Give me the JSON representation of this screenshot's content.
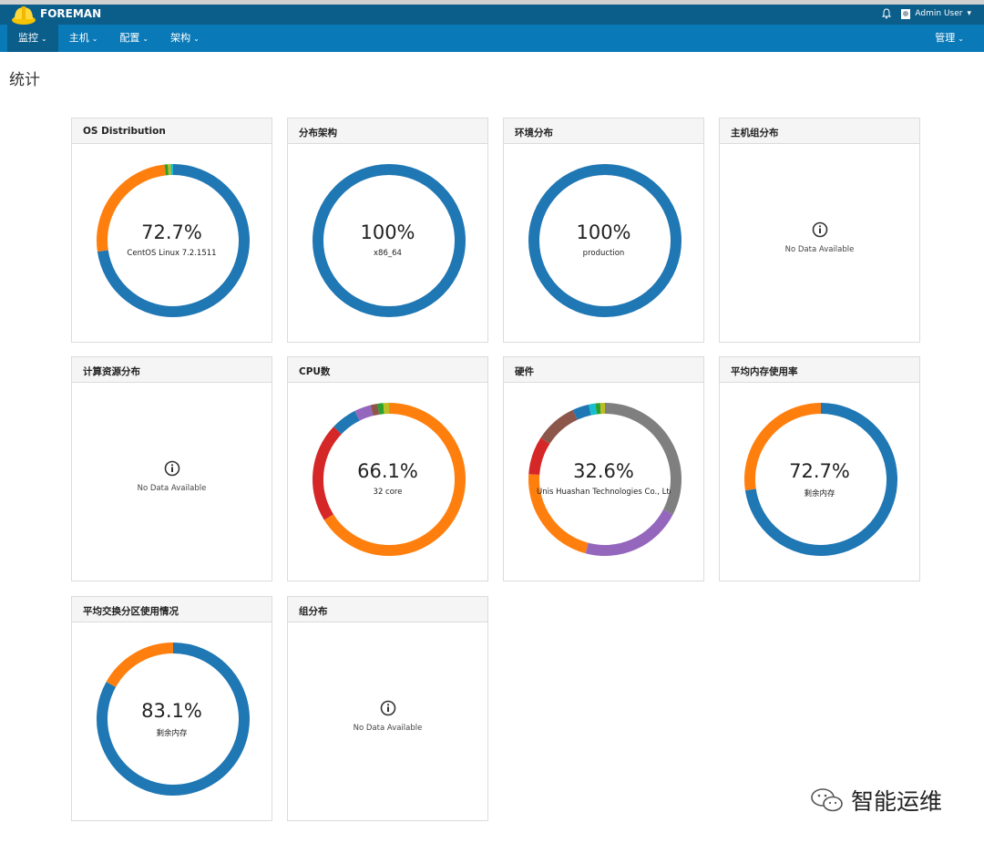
{
  "header": {
    "brand": "FOREMAN",
    "user": "Admin User",
    "user_caret": "▾"
  },
  "nav": {
    "items": [
      {
        "label": "监控",
        "caret": "⌄"
      },
      {
        "label": "主机",
        "caret": "⌄"
      },
      {
        "label": "配置",
        "caret": "⌄"
      },
      {
        "label": "架构",
        "caret": "⌄"
      }
    ],
    "admin": {
      "label": "管理",
      "caret": "⌄"
    }
  },
  "page": {
    "title": "统计"
  },
  "cards": [
    {
      "title": "OS Distribution",
      "percent": "72.7%",
      "label": "CentOS Linux 7.2.1511"
    },
    {
      "title": "分布架构",
      "percent": "100%",
      "label": "x86_64"
    },
    {
      "title": "环境分布",
      "percent": "100%",
      "label": "production"
    },
    {
      "title": "主机组分布",
      "nodata": "No Data Available"
    },
    {
      "title": "计算资源分布",
      "nodata": "No Data Available"
    },
    {
      "title": "CPU数",
      "percent": "66.1%",
      "label": "32 core"
    },
    {
      "title": "硬件",
      "percent": "32.6%",
      "label": "Unis Huashan Technologies Co., Ltd."
    },
    {
      "title": "平均内存使用率",
      "percent": "72.7%",
      "label": "剩余内存"
    },
    {
      "title": "平均交换分区使用情况",
      "percent": "83.1%",
      "label": "剩余内存"
    },
    {
      "title": "组分布",
      "nodata": "No Data Available"
    }
  ],
  "chart_data": [
    {
      "type": "pie",
      "title": "OS Distribution",
      "slices": [
        {
          "value": 72.7,
          "color": "#1f77b4"
        },
        {
          "value": 25.5,
          "color": "#ff7f0e"
        },
        {
          "value": 0.7,
          "color": "#2ca02c"
        },
        {
          "value": 0.6,
          "color": "#bcbd22"
        },
        {
          "value": 0.5,
          "color": "#17becf"
        }
      ]
    },
    {
      "type": "pie",
      "title": "分布架构",
      "slices": [
        {
          "value": 100,
          "color": "#1f77b4"
        }
      ]
    },
    {
      "type": "pie",
      "title": "环境分布",
      "slices": [
        {
          "value": 100,
          "color": "#1f77b4"
        }
      ]
    },
    {
      "type": "pie",
      "title": "CPU数",
      "slices": [
        {
          "value": 66.1,
          "color": "#ff7f0e"
        },
        {
          "value": 21.0,
          "color": "#d62728"
        },
        {
          "value": 5.5,
          "color": "#1f77b4"
        },
        {
          "value": 3.5,
          "color": "#9467bd"
        },
        {
          "value": 1.5,
          "color": "#8c564b"
        },
        {
          "value": 1.2,
          "color": "#2ca02c"
        },
        {
          "value": 1.2,
          "color": "#bcbd22"
        }
      ]
    },
    {
      "type": "pie",
      "title": "硬件",
      "slices": [
        {
          "value": 32.6,
          "color": "#7f7f7f"
        },
        {
          "value": 21.5,
          "color": "#9467bd"
        },
        {
          "value": 22.0,
          "color": "#ff7f0e"
        },
        {
          "value": 8.0,
          "color": "#d62728"
        },
        {
          "value": 9.0,
          "color": "#8c564b"
        },
        {
          "value": 3.5,
          "color": "#1f77b4"
        },
        {
          "value": 1.4,
          "color": "#17becf"
        },
        {
          "value": 1.0,
          "color": "#2ca02c"
        },
        {
          "value": 1.0,
          "color": "#bcbd22"
        }
      ]
    },
    {
      "type": "pie",
      "title": "平均内存使用率",
      "slices": [
        {
          "value": 72.7,
          "color": "#1f77b4"
        },
        {
          "value": 27.3,
          "color": "#ff7f0e"
        }
      ]
    },
    {
      "type": "pie",
      "title": "平均交换分区使用情况",
      "slices": [
        {
          "value": 83.1,
          "color": "#1f77b4"
        },
        {
          "value": 16.9,
          "color": "#ff7f0e"
        }
      ]
    }
  ],
  "watermark": {
    "text": "智能运维"
  }
}
